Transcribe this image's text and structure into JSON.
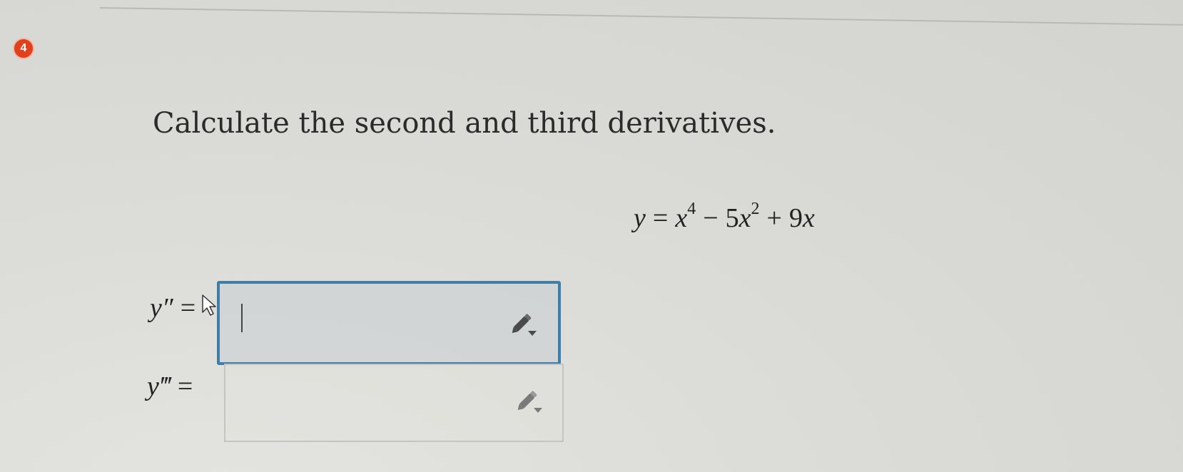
{
  "question": {
    "number": "4",
    "prompt": "Calculate the second and third derivatives."
  },
  "equation": {
    "lhs": "y",
    "equals": "=",
    "term1_var": "x",
    "term1_exp": "4",
    "op1": "−",
    "term2_coef": "5",
    "term2_var": "x",
    "term2_exp": "2",
    "op2": "+",
    "term3_coef": "9",
    "term3_var": "x"
  },
  "answers": {
    "second": {
      "label": "y″",
      "equals": "=",
      "value": "",
      "focused": true,
      "tool_icon": "pencil-dropdown-icon"
    },
    "third": {
      "label": "y‴",
      "equals": "=",
      "value": "",
      "focused": false,
      "tool_icon": "pencil-dropdown-icon"
    }
  },
  "colors": {
    "badge": "#e0401c",
    "focus_border": "#3f7fa7",
    "text": "#2b2b2b"
  }
}
